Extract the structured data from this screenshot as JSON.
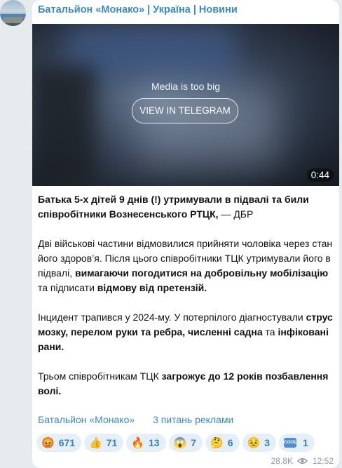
{
  "channel_name": "Батальйон «Монако» | Україна | Новини",
  "media": {
    "notice": "Media is too big",
    "button_label": "VIEW IN TELEGRAM",
    "duration": "0:44"
  },
  "post": {
    "p1_b": "Батька 5-х дітей 9 днів (!) утримували в підвалі та били співробітники Вознесенського РТЦК,",
    "p1_t": " — ДБР",
    "p2_t1": "Дві військові частини відмовилися прийняти чоловіка через стан його здоров’я. Після цього співробітники ТЦК утримували його в підвалі, ",
    "p2_b1": "вимагаючи погодитися на добровільну мобілізацію",
    "p2_t2": " та підписати ",
    "p2_b2": "відмову від претензій.",
    "p3_t1": "Інцидент трапився у 2024-му. У потерпілого діагностували ",
    "p3_b1": "струс мозку, перелом руки та ребра, численні садна",
    "p3_t2": " та ",
    "p3_b2": "інфіковані рани.",
    "p4_t1": "Трьом співробітникам ТЦК ",
    "p4_b1": "загрожує до 12 років позбавлення волі."
  },
  "links": {
    "channel": "Батальйон «Монако»",
    "ads": "3 питань реклами"
  },
  "reactions": [
    {
      "icon": "angry-face-icon",
      "emoji": "😡",
      "count": "671"
    },
    {
      "icon": "thumbs-up-icon",
      "emoji": "👍",
      "count": "71"
    },
    {
      "icon": "fire-icon",
      "emoji": "🔥",
      "count": "13"
    },
    {
      "icon": "screaming-face-icon",
      "emoji": "😱",
      "count": "7"
    },
    {
      "icon": "thinking-face-icon",
      "emoji": "🤔",
      "count": "6"
    },
    {
      "icon": "confounded-face-icon",
      "emoji": "😣",
      "count": "3"
    },
    {
      "icon": "cool-button-icon",
      "emoji": "COOL",
      "count": "1"
    }
  ],
  "meta": {
    "views": "28.8K",
    "time": "12:52"
  }
}
